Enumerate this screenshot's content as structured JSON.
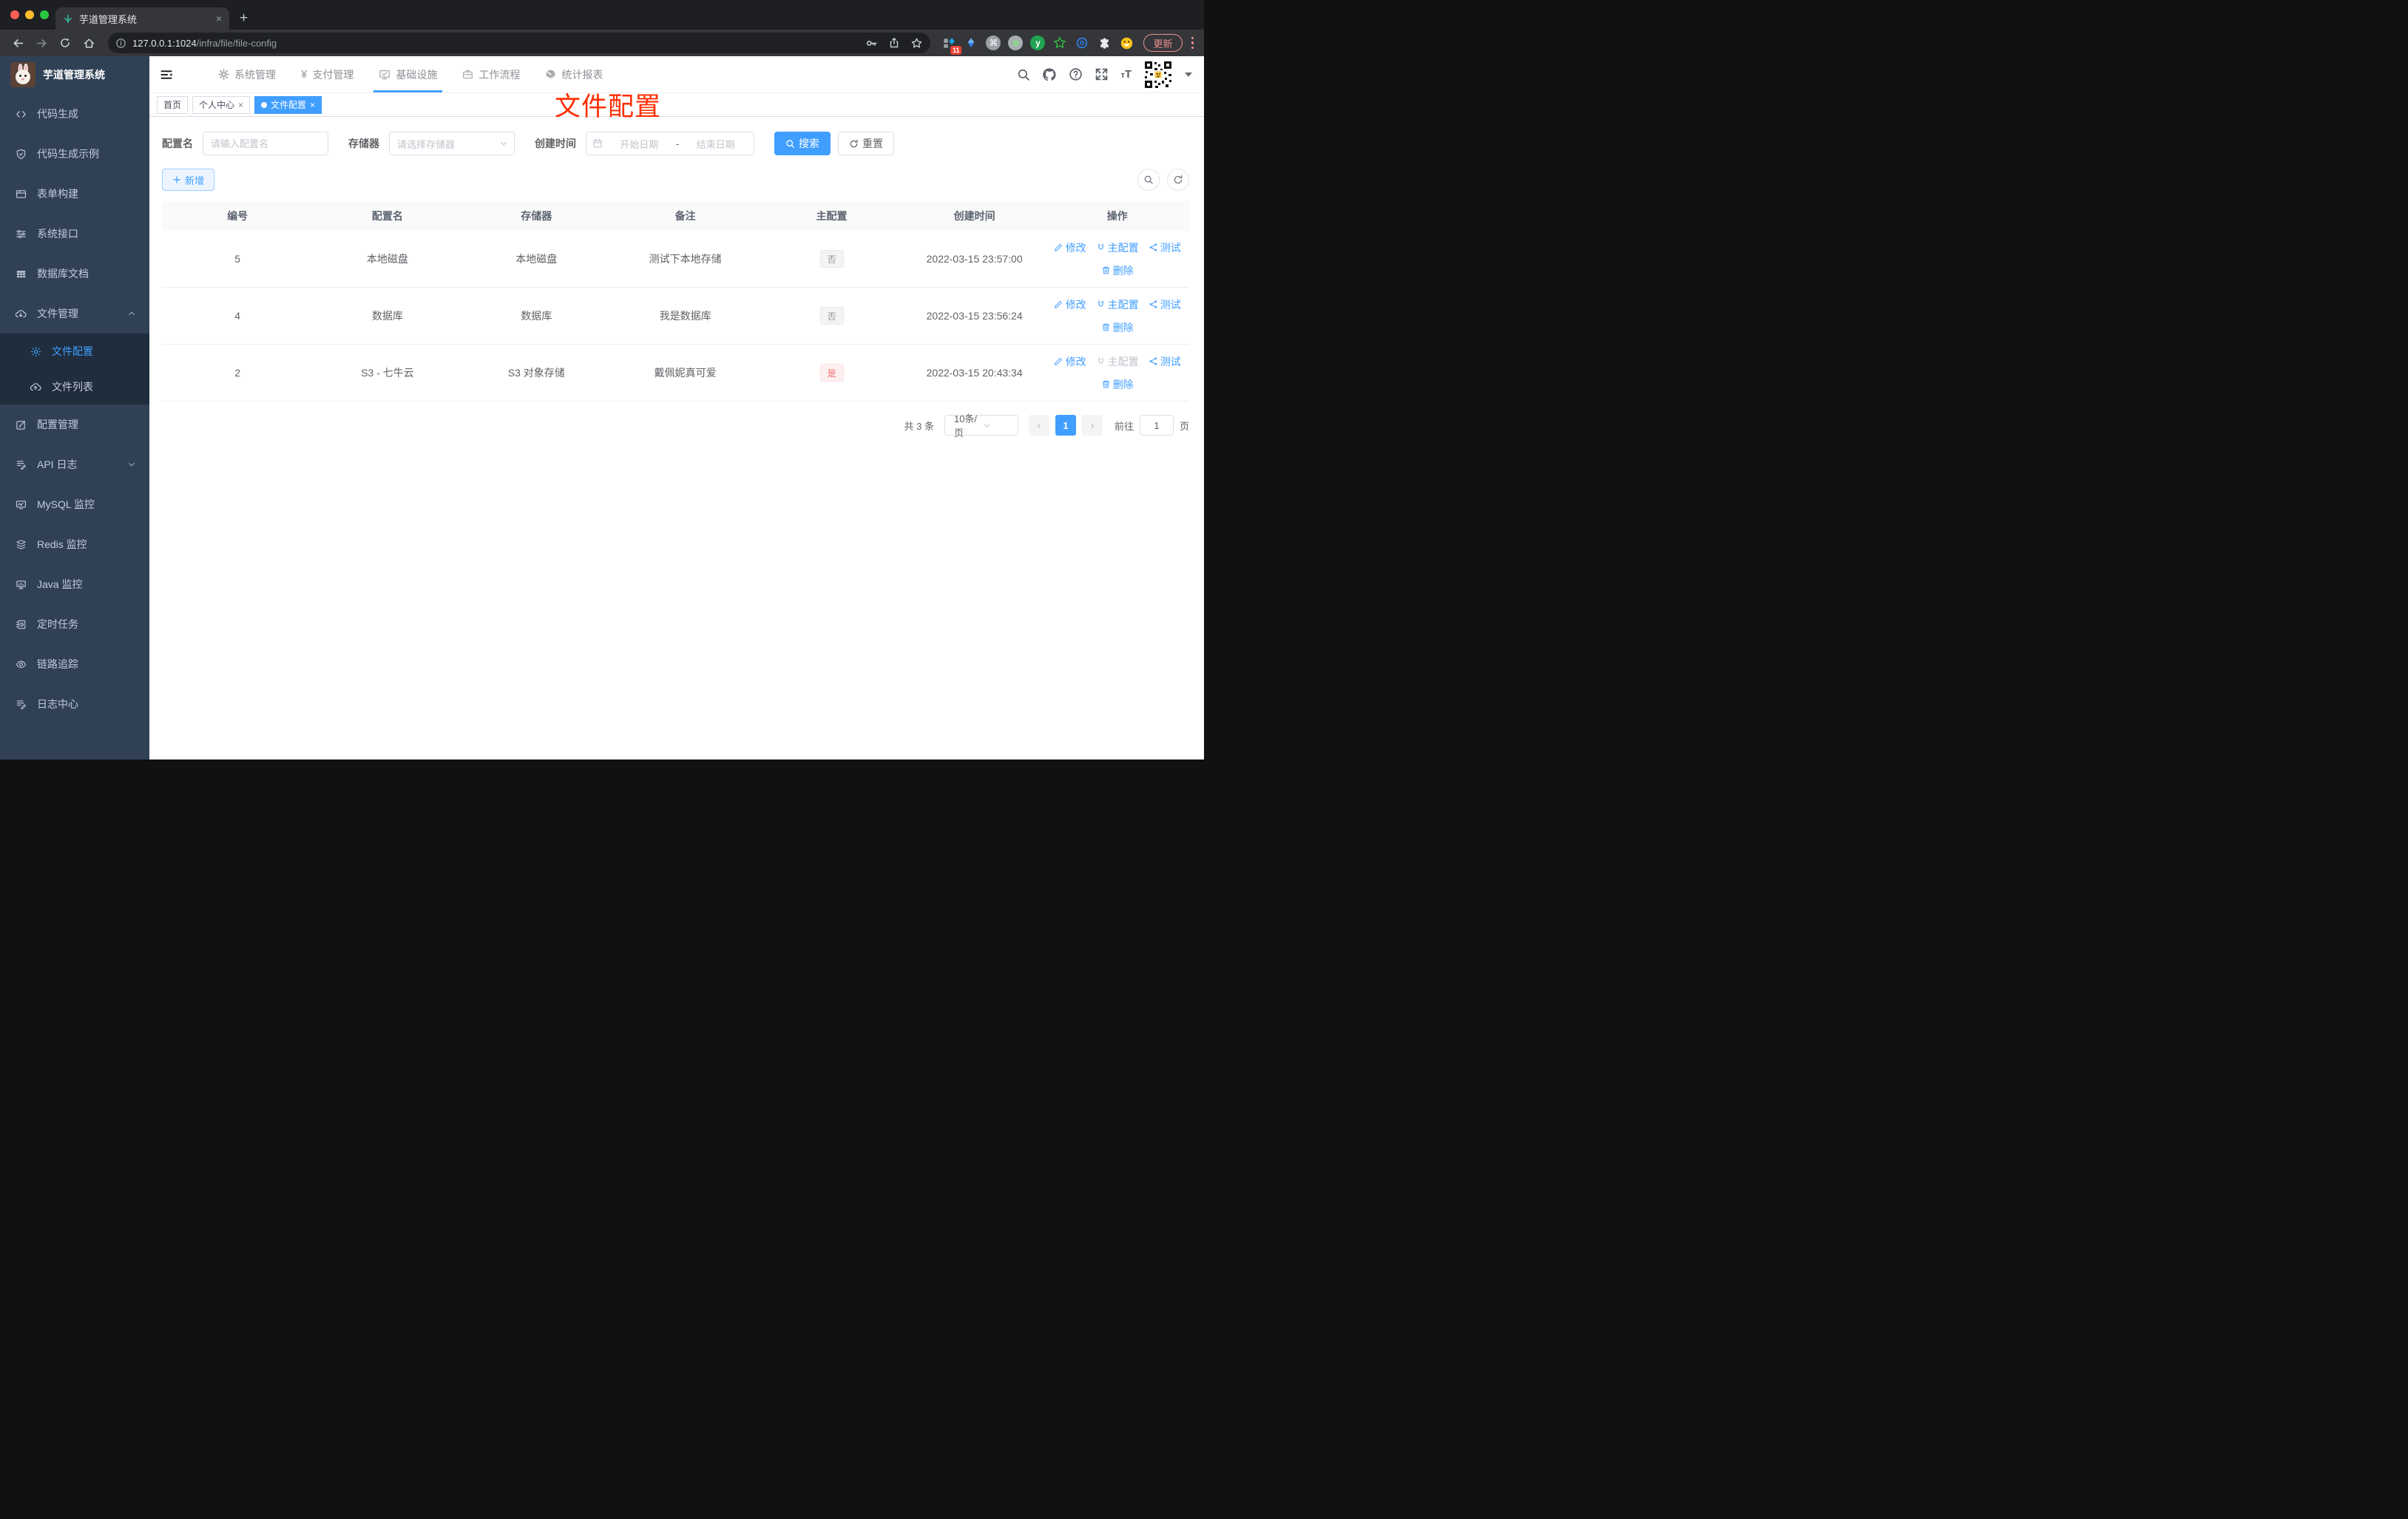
{
  "browser": {
    "tab_title": "芋道管理系统",
    "new_tab": "+",
    "url_host": "127.0.0.1:1024",
    "url_path": "/infra/file/file-config",
    "extensions_badge": "11",
    "extension_icons": [
      "grid-diamond",
      "kite",
      "command",
      "record-dot",
      "y-circle",
      "green-star",
      "blue-eye",
      "puzzle",
      "emoji-face"
    ],
    "update_label": "更新"
  },
  "sidebar": {
    "logo_title": "芋道管理系统",
    "items": [
      {
        "label": "代码生成"
      },
      {
        "label": "代码生成示例"
      },
      {
        "label": "表单构建"
      },
      {
        "label": "系统接口"
      },
      {
        "label": "数据库文档"
      },
      {
        "label": "文件管理"
      },
      {
        "label": "文件配置"
      },
      {
        "label": "文件列表"
      },
      {
        "label": "配置管理"
      },
      {
        "label": "API 日志"
      },
      {
        "label": "MySQL 监控"
      },
      {
        "label": "Redis 监控"
      },
      {
        "label": "Java 监控"
      },
      {
        "label": "定时任务"
      },
      {
        "label": "链路追踪"
      },
      {
        "label": "日志中心"
      }
    ]
  },
  "navbar": {
    "menus": [
      {
        "label": "系统管理"
      },
      {
        "label": "支付管理"
      },
      {
        "label": "基础设施",
        "active": true
      },
      {
        "label": "工作流程"
      },
      {
        "label": "统计报表"
      }
    ]
  },
  "tags": [
    {
      "label": "首页"
    },
    {
      "label": "个人中心",
      "closable": true
    },
    {
      "label": "文件配置",
      "active": true,
      "closable": true
    }
  ],
  "annotation": {
    "text": "文件配置",
    "color": "#ff2d00"
  },
  "filter": {
    "name_label": "配置名",
    "name_placeholder": "请输入配置名",
    "storage_label": "存储器",
    "storage_placeholder": "请选择存储器",
    "time_label": "创建时间",
    "start_placeholder": "开始日期",
    "range_separator": "-",
    "end_placeholder": "结束日期",
    "search_label": "搜索",
    "reset_label": "重置"
  },
  "toolbar": {
    "add_label": "新增"
  },
  "table": {
    "columns": [
      "编号",
      "配置名",
      "存储器",
      "备注",
      "主配置",
      "创建时间",
      "操作"
    ],
    "actions": {
      "edit": "修改",
      "master": "主配置",
      "test": "测试",
      "delete": "删除"
    },
    "rows": [
      {
        "id": "5",
        "name": "本地磁盘",
        "storage": "本地磁盘",
        "remark": "测试下本地存储",
        "master": "否",
        "master_type": "info",
        "created": "2022-03-15 23:57:00",
        "master_disabled": false
      },
      {
        "id": "4",
        "name": "数据库",
        "storage": "数据库",
        "remark": "我是数据库",
        "master": "否",
        "master_type": "info",
        "created": "2022-03-15 23:56:24",
        "master_disabled": false
      },
      {
        "id": "2",
        "name": "S3 - 七牛云",
        "storage": "S3 对象存储",
        "remark": "戴佩妮真可爱",
        "master": "是",
        "master_type": "danger",
        "created": "2022-03-15 20:43:34",
        "master_disabled": true
      }
    ]
  },
  "pagination": {
    "total": "共 3 条",
    "page_size": "10条/页",
    "current_page": "1",
    "goto_label": "前往",
    "goto_value": "1",
    "page_unit": "页"
  },
  "colors": {
    "accent": "#409eff",
    "danger": "#f56c6c",
    "annotation_red": "#ff2d00",
    "sidebar_bg": "#304156",
    "submenu_bg": "#1f2d3d"
  }
}
